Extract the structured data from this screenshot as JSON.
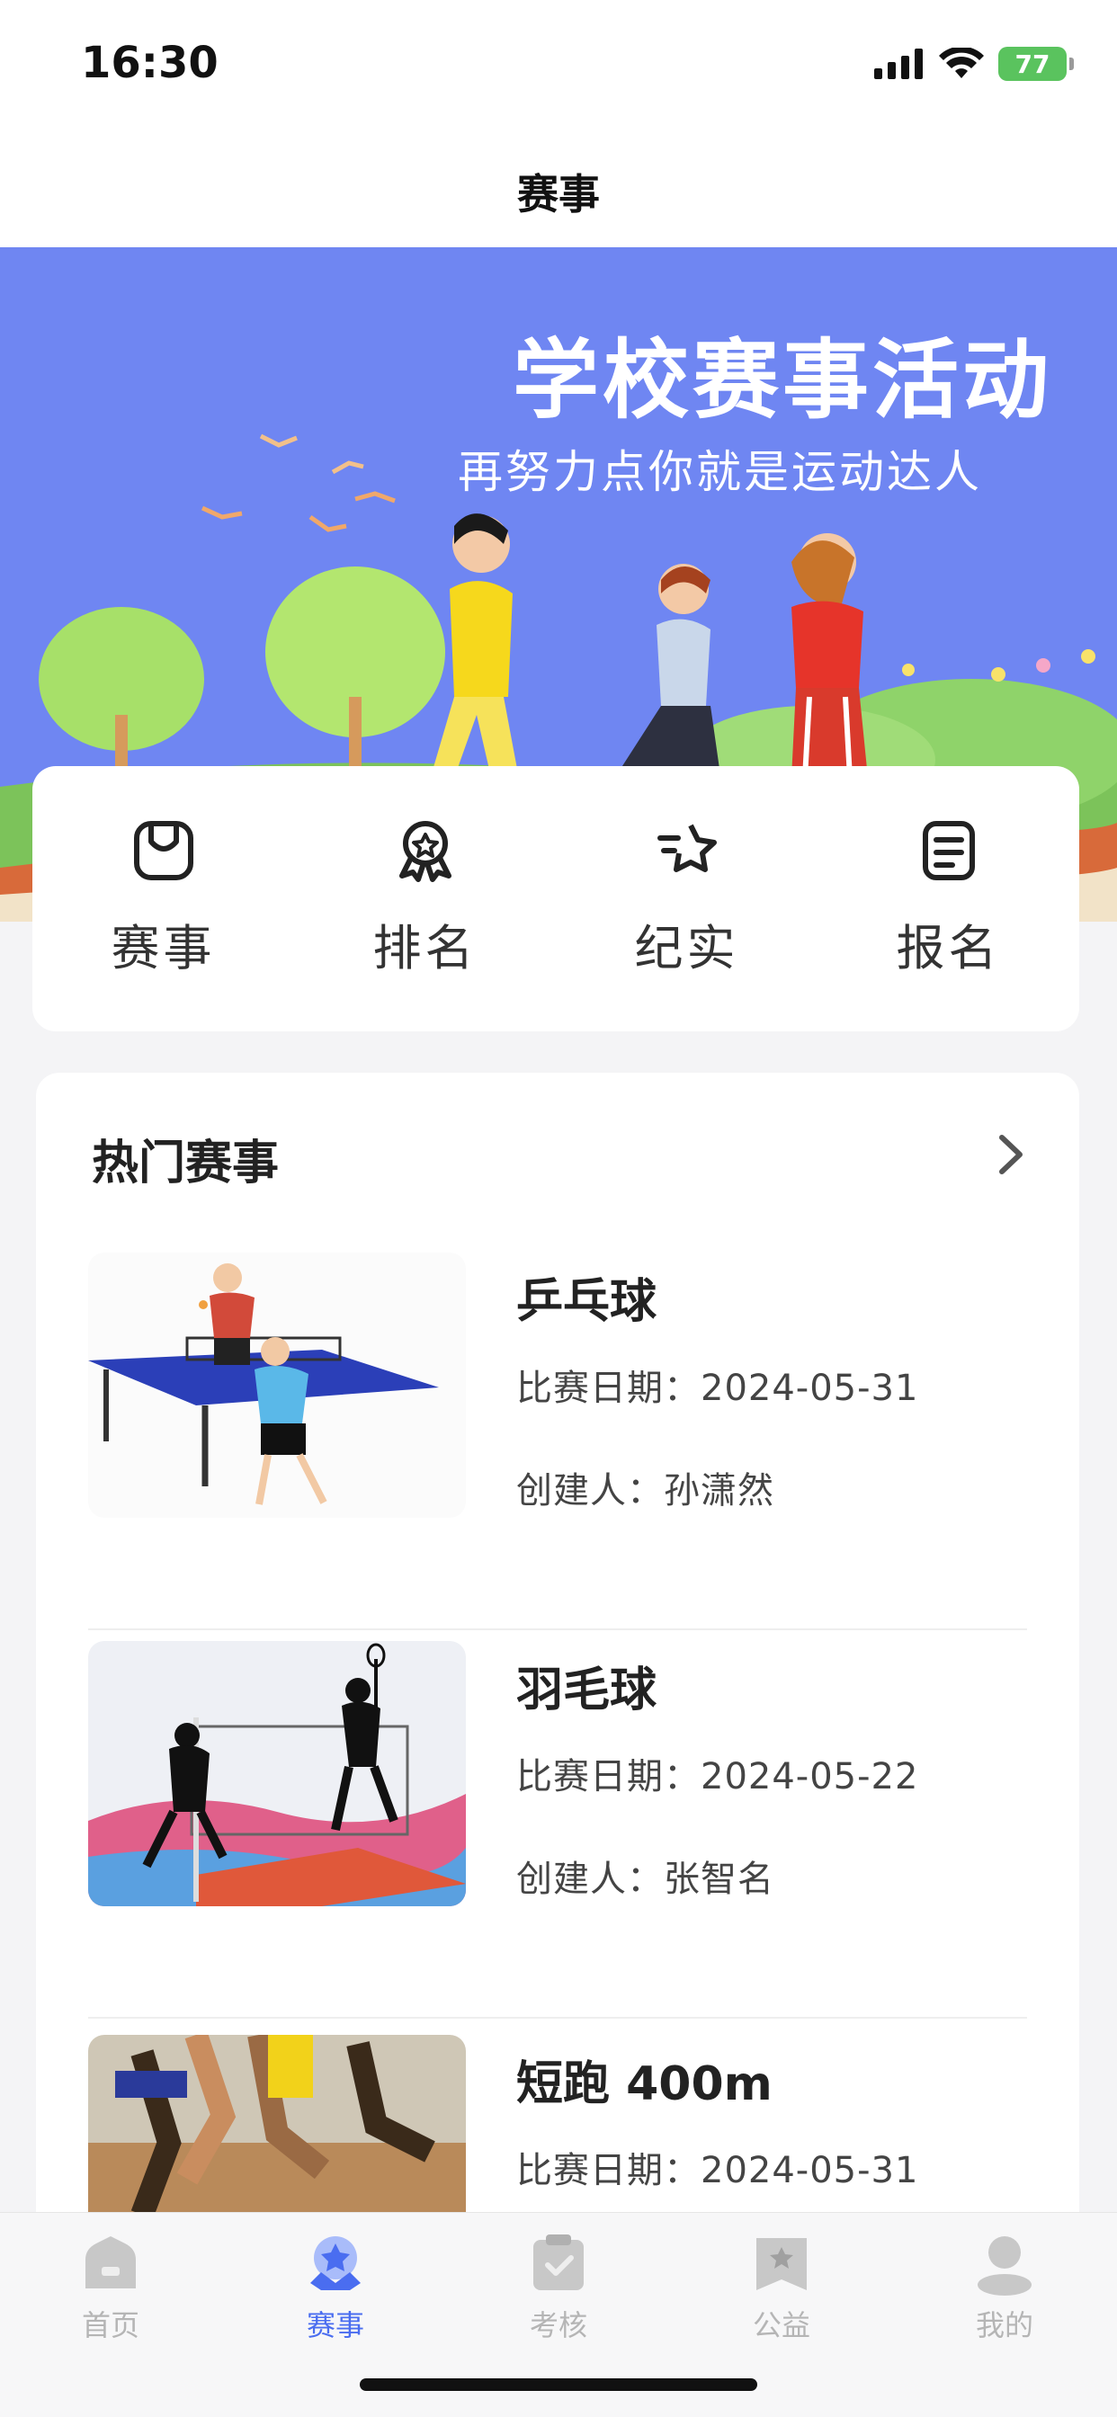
{
  "status": {
    "time": "16:30",
    "battery": "77"
  },
  "nav": {
    "title": "赛事"
  },
  "banner": {
    "title": "学校赛事活动",
    "subtitle": "再努力点你就是运动达人"
  },
  "quick_actions": [
    {
      "label": "赛事",
      "icon": "bag-icon"
    },
    {
      "label": "排名",
      "icon": "award-icon"
    },
    {
      "label": "纪实",
      "icon": "star-icon"
    },
    {
      "label": "报名",
      "icon": "document-icon"
    }
  ],
  "hot": {
    "header": "热门赛事",
    "events": [
      {
        "title": "乒乓球",
        "date": "比赛日期：2024-05-31",
        "creator": "创建人：孙潇然"
      },
      {
        "title": "羽毛球",
        "date": "比赛日期：2024-05-22",
        "creator": "创建人：张智名"
      },
      {
        "title": "短跑 400m",
        "date": "比赛日期：2024-05-31",
        "creator": ""
      }
    ]
  },
  "tabs": [
    {
      "label": "首页",
      "icon": "home-icon",
      "active": false
    },
    {
      "label": "赛事",
      "icon": "events-star-icon",
      "active": true
    },
    {
      "label": "考核",
      "icon": "clipboard-check-icon",
      "active": false
    },
    {
      "label": "公益",
      "icon": "bookmark-star-icon",
      "active": false
    },
    {
      "label": "我的",
      "icon": "profile-icon",
      "active": false
    }
  ],
  "colors": {
    "accent": "#4a6df0",
    "banner": "#6f86f2",
    "battery": "#5ac35e"
  }
}
